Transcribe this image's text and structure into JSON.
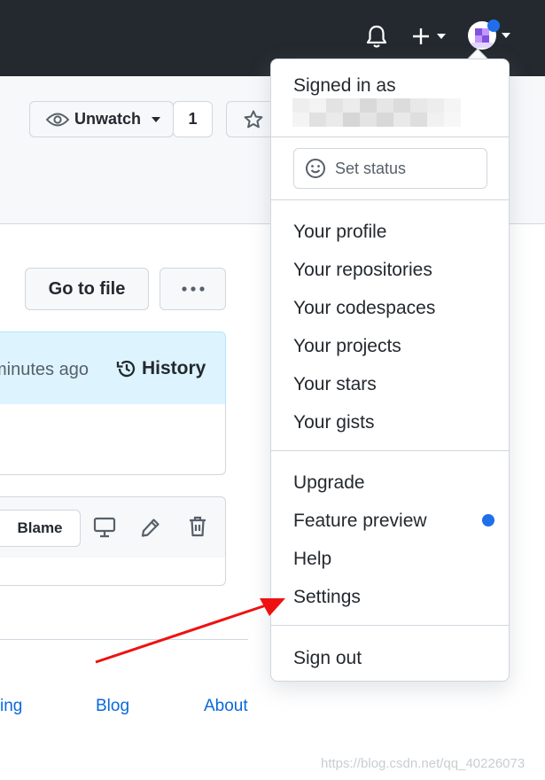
{
  "header": {
    "notification_icon": "bell-icon",
    "create_icon": "plus-icon",
    "avatar_badge_color": "#1f6feb"
  },
  "repo": {
    "watch": {
      "label": "Unwatch",
      "count": "1"
    },
    "star_icon": "star-icon",
    "go_to_file": "Go to file",
    "more_icon": "kebab-horizontal-icon",
    "commit": {
      "time_text": "minutes ago",
      "history_label": "History"
    },
    "file_actions": {
      "blame_label": "Blame"
    }
  },
  "footer": {
    "links": [
      "ing",
      "Blog",
      "About"
    ]
  },
  "menu": {
    "signed_in_label": "Signed in as",
    "status_placeholder": "Set status",
    "group1": [
      "Your profile",
      "Your repositories",
      "Your codespaces",
      "Your projects",
      "Your stars",
      "Your gists"
    ],
    "group2": [
      "Upgrade",
      "Feature preview",
      "Help",
      "Settings"
    ],
    "feature_preview_dot_color": "#1f6feb",
    "sign_out": "Sign out"
  },
  "annotation": {
    "arrow_color": "#ee1111"
  },
  "watermark": "https://blog.csdn.net/qq_40226073"
}
